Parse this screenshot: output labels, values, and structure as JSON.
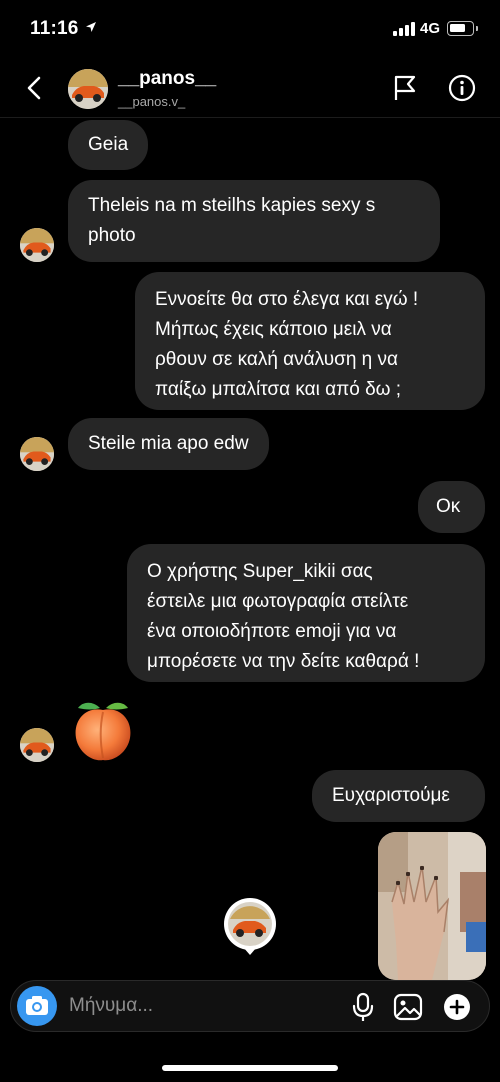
{
  "status_bar": {
    "time": "11:16",
    "network": "4G",
    "battery_level": 0.7
  },
  "header": {
    "display_name": "__panos__",
    "username": "__panos.v_",
    "back_icon": "chevron-left-icon",
    "flag_icon": "flag-icon",
    "info_icon": "info-icon"
  },
  "messages": [
    {
      "direction": "incoming",
      "text": "Geia"
    },
    {
      "direction": "incoming",
      "lines": [
        "Theleis na m steilhs kapies sexy s",
        "photo"
      ]
    },
    {
      "direction": "outgoing",
      "lines": [
        "Εννοείτε θα στο έλεγα και εγώ !",
        "Μήπως έχεις κάποιο μειλ να",
        "ρθουν σε καλή ανάλυση η να",
        "παίξω μπαλίτσα και από δω ;"
      ]
    },
    {
      "direction": "incoming",
      "text": "Steile mia apo edw"
    },
    {
      "direction": "outgoing",
      "text": "Οκ"
    },
    {
      "direction": "outgoing",
      "lines": [
        "Ο χρήστης Super_kikii σας",
        "έστειλε μια φωτογραφία στείλτε",
        "ένα οποιοδήποτε emoji για να",
        "μπορέσετε να την δείτε καθαρά !"
      ]
    },
    {
      "direction": "incoming",
      "type": "emoji",
      "emoji_name": "peach-emoji"
    },
    {
      "direction": "outgoing",
      "text": "Ευχαριστούμε"
    },
    {
      "direction": "outgoing",
      "type": "photo",
      "image_name": "hand-photo"
    }
  ],
  "composer": {
    "placeholder": "Μήνυμα..."
  },
  "colors": {
    "background": "#000000",
    "bubble": "#262626",
    "accent": "#3797f0"
  }
}
